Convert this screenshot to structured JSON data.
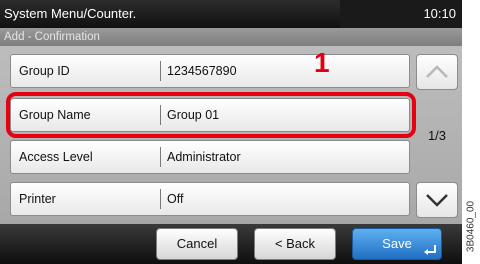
{
  "header": {
    "menu_title": "System Menu/Counter.",
    "time": "10:10"
  },
  "subtitle": "Add - Confirmation",
  "rows": [
    {
      "label": "Group ID",
      "value": "1234567890"
    },
    {
      "label": "Group Name",
      "value": "Group 01"
    },
    {
      "label": "Access Level",
      "value": "Administrator"
    },
    {
      "label": "Printer",
      "value": "Off"
    }
  ],
  "callout": "1",
  "pagination": {
    "indicator": "1/3"
  },
  "buttons": {
    "cancel": "Cancel",
    "back": "< Back",
    "save": "Save"
  },
  "icons": {
    "scroll_up": "chevron-up-icon",
    "scroll_down": "chevron-down-icon",
    "enter": "enter-icon"
  },
  "colors": {
    "highlight": "#e60012",
    "save": "#2f86d6"
  },
  "figure_code": "3B0460_00"
}
